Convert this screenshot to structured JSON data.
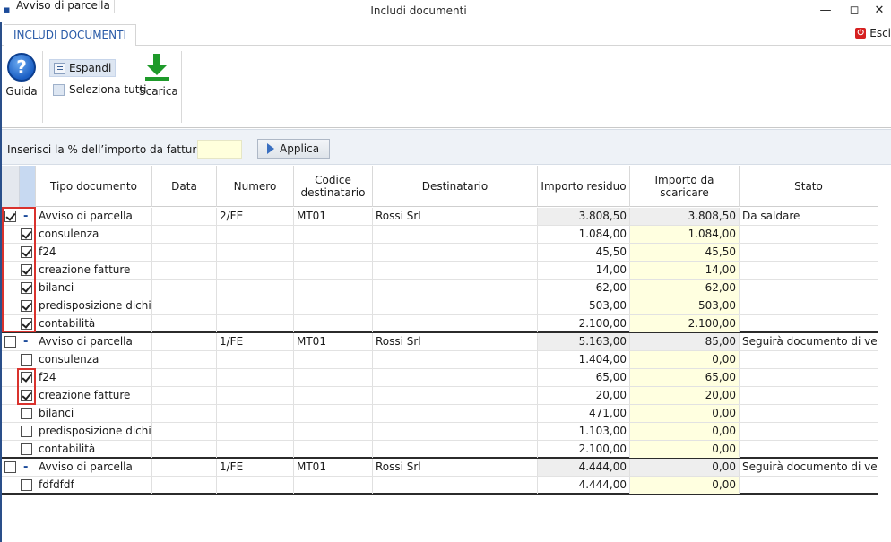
{
  "window": {
    "app_tab": "Avviso di parcella",
    "title": "Includi documenti",
    "minimize_icon": "minimize-icon",
    "maximize_icon": "maximize-icon",
    "close_icon": "close-icon"
  },
  "ribbon": {
    "tab": "INCLUDI DOCUMENTI",
    "exit_label": "Esci",
    "guida_label": "Guida",
    "espandi_label": "Espandi",
    "seleziona_tutti_label": "Seleziona tutti",
    "scarica_label": "Scarica"
  },
  "percent_bar": {
    "label": "Inserisci la % dell’importo da fatturare",
    "value": "",
    "apply_label": "Applica"
  },
  "grid": {
    "columns": [
      "Tipo documento",
      "Data",
      "Numero",
      "Codice destinatario",
      "Destinatario",
      "Importo residuo",
      "Importo da scaricare",
      "Stato"
    ],
    "groups": [
      {
        "parent": {
          "checked": true,
          "tipo": "Avviso di parcella",
          "data": "",
          "numero": "2/FE",
          "codice": "MT01",
          "destinatario": "Rossi Srl",
          "residuo": "3.808,50",
          "scaricare": "3.808,50",
          "stato": "Da saldare"
        },
        "children": [
          {
            "checked": true,
            "tipo": "consulenza",
            "residuo": "1.084,00",
            "scaricare": "1.084,00"
          },
          {
            "checked": true,
            "tipo": "f24",
            "residuo": "45,50",
            "scaricare": "45,50"
          },
          {
            "checked": true,
            "tipo": "creazione fatture",
            "residuo": "14,00",
            "scaricare": "14,00"
          },
          {
            "checked": true,
            "tipo": "bilanci",
            "residuo": "62,00",
            "scaricare": "62,00"
          },
          {
            "checked": true,
            "tipo": "predisposizione dichiarativi",
            "residuo": "503,00",
            "scaricare": "503,00"
          },
          {
            "checked": true,
            "tipo": "contabilità",
            "residuo": "2.100,00",
            "scaricare": "2.100,00"
          }
        ]
      },
      {
        "parent": {
          "checked": false,
          "tipo": "Avviso di parcella",
          "data": "",
          "numero": "1/FE",
          "codice": "MT01",
          "destinatario": "Rossi Srl",
          "residuo": "5.163,00",
          "scaricare": "85,00",
          "stato": "Seguirà documento di vendita"
        },
        "children": [
          {
            "checked": false,
            "tipo": "consulenza",
            "residuo": "1.404,00",
            "scaricare": "0,00"
          },
          {
            "checked": true,
            "tipo": "f24",
            "residuo": "65,00",
            "scaricare": "65,00"
          },
          {
            "checked": true,
            "tipo": "creazione fatture",
            "residuo": "20,00",
            "scaricare": "20,00"
          },
          {
            "checked": false,
            "tipo": "bilanci",
            "residuo": "471,00",
            "scaricare": "0,00"
          },
          {
            "checked": false,
            "tipo": "predisposizione dichiarativi",
            "residuo": "1.103,00",
            "scaricare": "0,00"
          },
          {
            "checked": false,
            "tipo": "contabilità",
            "residuo": "2.100,00",
            "scaricare": "0,00"
          }
        ]
      },
      {
        "parent": {
          "checked": false,
          "tipo": "Avviso di parcella",
          "data": "",
          "numero": "1/FE",
          "codice": "MT01",
          "destinatario": "Rossi Srl",
          "residuo": "4.444,00",
          "scaricare": "0,00",
          "stato": "Seguirà documento di vendita"
        },
        "children": [
          {
            "checked": false,
            "tipo": "fdfdfdf",
            "residuo": "4.444,00",
            "scaricare": "0,00"
          }
        ]
      }
    ]
  },
  "colors": {
    "highlight_box": "#d9322d",
    "edit_cell": "#ffffe0",
    "accent": "#2a5ba8"
  }
}
